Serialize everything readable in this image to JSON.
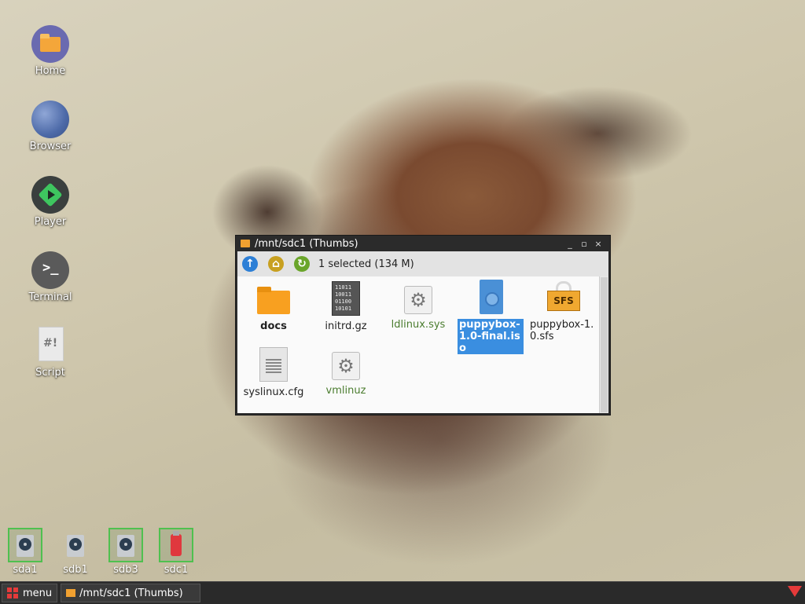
{
  "desktop": {
    "icons": [
      {
        "label": "Home",
        "icon": "home-folder-icon"
      },
      {
        "label": "Browser",
        "icon": "browser-globe-icon"
      },
      {
        "label": "Player",
        "icon": "player-icon"
      },
      {
        "label": "Terminal",
        "icon": "terminal-icon"
      },
      {
        "label": "Script",
        "icon": "script-icon",
        "glyph": "#!"
      }
    ],
    "drives": [
      {
        "label": "sda1",
        "icon": "hard-drive-icon",
        "mounted": true
      },
      {
        "label": "sdb1",
        "icon": "hard-drive-icon",
        "mounted": false
      },
      {
        "label": "sdb3",
        "icon": "hard-drive-icon",
        "mounted": true
      },
      {
        "label": "sdc1",
        "icon": "usb-drive-icon",
        "mounted": true
      }
    ]
  },
  "window": {
    "title": "/mnt/sdc1 (Thumbs)",
    "controls": {
      "minimize": "_",
      "maximize": "▫",
      "close": "×"
    },
    "status": "1 selected (134 M)",
    "files": [
      {
        "name": "docs",
        "type": "folder"
      },
      {
        "name": "initrd.gz",
        "type": "binary",
        "glyph": "11011\n10011\n01100\n10101"
      },
      {
        "name": "ldlinux.sys",
        "type": "system"
      },
      {
        "name": "puppybox-1.0-final.iso",
        "type": "iso",
        "selected": true
      },
      {
        "name": "puppybox-1.0.sfs",
        "type": "sfs",
        "glyph": "SFS"
      },
      {
        "name": "syslinux.cfg",
        "type": "text"
      },
      {
        "name": "vmlinuz",
        "type": "system"
      }
    ]
  },
  "taskbar": {
    "menu_label": "menu",
    "task_label": "/mnt/sdc1 (Thumbs)"
  },
  "colors": {
    "accent": "#3a8ee0",
    "mounted_border": "#4fc04f",
    "menu_red": "#e53a3a",
    "system_file_text": "#4a7c2e"
  }
}
